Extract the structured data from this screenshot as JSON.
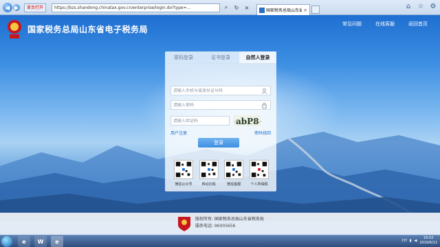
{
  "browser": {
    "favorites_label": "首页打开",
    "url": "https://bzs.shandong.chinatax.gov.cn/enterprise/login.do?type=...",
    "tab_title": "国家税务总局山东省电子税...",
    "tab_close": "×",
    "icons": [
      "back-icon",
      "forward-icon",
      "home-icon",
      "star-icon",
      "gear-icon"
    ]
  },
  "header": {
    "title": "国家税务总局山东省电子税务局",
    "links": [
      "常见问题",
      "在线客服",
      "返回首页"
    ]
  },
  "login": {
    "tabs": [
      "密码登录",
      "证书登录",
      "自然人登录"
    ],
    "active_tab": 2,
    "account_placeholder": "请输入手机号或身份证号码",
    "password_placeholder": "请输入密码",
    "captcha_placeholder": "请输入验证码",
    "captcha_text": "abP8",
    "register_link": "用户注册",
    "forgot_link": "密码找回",
    "submit_label": "登录",
    "qr_codes": [
      "微信公众号",
      "移动办税",
      "微信客服",
      "个人所得税"
    ]
  },
  "footer": {
    "copyright": "版权所有: 国家税务总局山东省税务局",
    "phone": "服务电话: 96005656"
  },
  "taskbar": {
    "apps": [
      "e",
      "W",
      "e"
    ],
    "tray_text": "CH",
    "time": "16:52",
    "date": "2019/6/11"
  },
  "colors": {
    "accent": "#3f8fe0",
    "link": "#1a6fd0",
    "brand_red": "#c8161d"
  }
}
